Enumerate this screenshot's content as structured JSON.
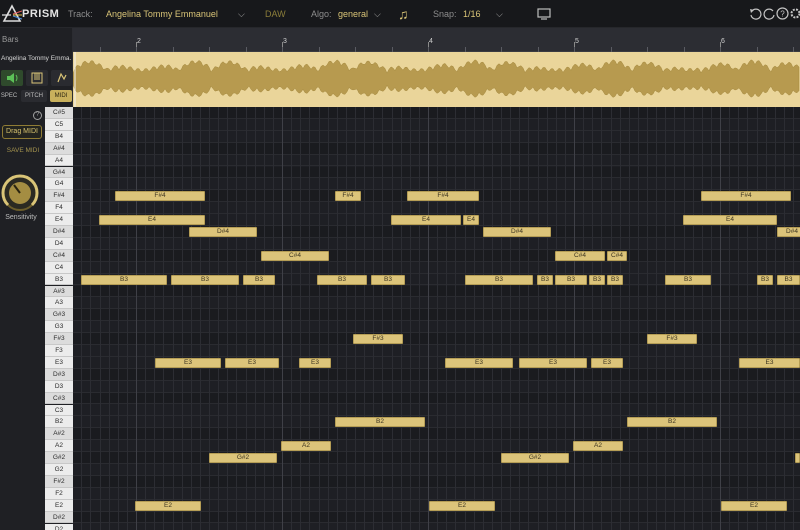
{
  "header": {
    "app_name": "PRISM",
    "track_label": "Track:",
    "track_value": "Angelina  Tommy Emmanuel",
    "daw_label": "DAW",
    "algo_label": "Algo:",
    "algo_value": "general",
    "snap_label": "Snap:",
    "snap_value": "1/16"
  },
  "sidebar": {
    "bars_label": "Bars",
    "track_name": "Angelina  Tommy Emma...",
    "btn_spec": "SPEC",
    "btn_pitch": "PITCH",
    "btn_midi": "MIDI",
    "drag_midi": "Drag MIDI",
    "save_midi": "SAVE MIDI",
    "sensitivity": "Sensitivity"
  },
  "ruler": {
    "bars": [
      "2",
      "3",
      "4",
      "5",
      "6"
    ]
  },
  "keys": [
    "C#5",
    "C5",
    "B4",
    "A#4",
    "A4",
    "G#4",
    "G4",
    "F#4",
    "F4",
    "E4",
    "D#4",
    "D4",
    "C#4",
    "C4",
    "B3",
    "A#3",
    "A3",
    "G#3",
    "G3",
    "F#3",
    "F3",
    "E3",
    "D#3",
    "D3",
    "C#3",
    "C3",
    "B2",
    "A#2",
    "A2",
    "G#2",
    "G2",
    "F#2",
    "F2",
    "E2",
    "D#2",
    "D2"
  ],
  "notes": [
    {
      "pitch": "F#4",
      "label": "F#4",
      "start": 42,
      "len": 90
    },
    {
      "pitch": "F#4",
      "label": "F#4",
      "start": 262,
      "len": 26
    },
    {
      "pitch": "F#4",
      "label": "F#4",
      "start": 334,
      "len": 72
    },
    {
      "pitch": "F#4",
      "label": "F#4",
      "start": 628,
      "len": 90
    },
    {
      "pitch": "E4",
      "label": "E4",
      "start": 26,
      "len": 106
    },
    {
      "pitch": "E4",
      "label": "E4",
      "start": 318,
      "len": 70
    },
    {
      "pitch": "E4",
      "label": "E4",
      "start": 390,
      "len": 16
    },
    {
      "pitch": "E4",
      "label": "E4",
      "start": 610,
      "len": 94
    },
    {
      "pitch": "D#4",
      "label": "D#4",
      "start": 116,
      "len": 68
    },
    {
      "pitch": "D#4",
      "label": "D#4",
      "start": 410,
      "len": 68
    },
    {
      "pitch": "D#4",
      "label": "D#4",
      "start": 704,
      "len": 30
    },
    {
      "pitch": "C#4",
      "label": "C#4",
      "start": 188,
      "len": 68
    },
    {
      "pitch": "C#4",
      "label": "C#4",
      "start": 482,
      "len": 50
    },
    {
      "pitch": "C#4",
      "label": "C#4",
      "start": 534,
      "len": 20
    },
    {
      "pitch": "B3",
      "label": "B3",
      "start": 8,
      "len": 86
    },
    {
      "pitch": "B3",
      "label": "B3",
      "start": 98,
      "len": 68
    },
    {
      "pitch": "B3",
      "label": "B3",
      "start": 170,
      "len": 32
    },
    {
      "pitch": "B3",
      "label": "B3",
      "start": 244,
      "len": 50
    },
    {
      "pitch": "B3",
      "label": "B3",
      "start": 298,
      "len": 34
    },
    {
      "pitch": "B3",
      "label": "B3",
      "start": 392,
      "len": 68
    },
    {
      "pitch": "B3",
      "label": "B3",
      "start": 464,
      "len": 16
    },
    {
      "pitch": "B3",
      "label": "B3",
      "start": 482,
      "len": 32
    },
    {
      "pitch": "B3",
      "label": "B3",
      "start": 516,
      "len": 16
    },
    {
      "pitch": "B3",
      "label": "B3",
      "start": 534,
      "len": 16
    },
    {
      "pitch": "B3",
      "label": "B3",
      "start": 592,
      "len": 46
    },
    {
      "pitch": "B3",
      "label": "B3",
      "start": 684,
      "len": 16
    },
    {
      "pitch": "B3",
      "label": "B3",
      "start": 704,
      "len": 23
    },
    {
      "pitch": "F#3",
      "label": "F#3",
      "start": 280,
      "len": 50
    },
    {
      "pitch": "F#3",
      "label": "F#3",
      "start": 574,
      "len": 50
    },
    {
      "pitch": "E3",
      "label": "E3",
      "start": 82,
      "len": 66
    },
    {
      "pitch": "E3",
      "label": "E3",
      "start": 152,
      "len": 54
    },
    {
      "pitch": "E3",
      "label": "E3",
      "start": 226,
      "len": 32
    },
    {
      "pitch": "E3",
      "label": "E3",
      "start": 372,
      "len": 68
    },
    {
      "pitch": "E3",
      "label": "E3",
      "start": 446,
      "len": 68
    },
    {
      "pitch": "E3",
      "label": "E3",
      "start": 518,
      "len": 32
    },
    {
      "pitch": "E3",
      "label": "E3",
      "start": 666,
      "len": 61
    },
    {
      "pitch": "B2",
      "label": "B2",
      "start": 262,
      "len": 90
    },
    {
      "pitch": "B2",
      "label": "B2",
      "start": 554,
      "len": 90
    },
    {
      "pitch": "A2",
      "label": "A2",
      "start": 208,
      "len": 50
    },
    {
      "pitch": "A2",
      "label": "A2",
      "start": 500,
      "len": 50
    },
    {
      "pitch": "G#2",
      "label": "G#2",
      "start": 136,
      "len": 68
    },
    {
      "pitch": "G#2",
      "label": "G#2",
      "start": 428,
      "len": 68
    },
    {
      "pitch": "G#2",
      "label": "",
      "start": 722,
      "len": 5
    },
    {
      "pitch": "E2",
      "label": "E2",
      "start": 62,
      "len": 66
    },
    {
      "pitch": "E2",
      "label": "E2",
      "start": 356,
      "len": 66
    },
    {
      "pitch": "E2",
      "label": "E2",
      "start": 648,
      "len": 66
    }
  ],
  "colors": {
    "accent": "#d9c477",
    "note_fill": "#dcc47a",
    "waveform_bg": "#ead59a",
    "waveform_fg": "#b79a4f",
    "midi_active": "#c8b05c",
    "speaker_green": "#4fae4b"
  },
  "icons": [
    "prism-logo-icon",
    "chevron-down-icon",
    "music-note-icon",
    "monitor-icon",
    "undo-icon",
    "redo-icon",
    "help-icon",
    "settings-icon",
    "speaker-icon",
    "piano-icon",
    "pitch-icon",
    "sensitivity-knob-icon"
  ]
}
